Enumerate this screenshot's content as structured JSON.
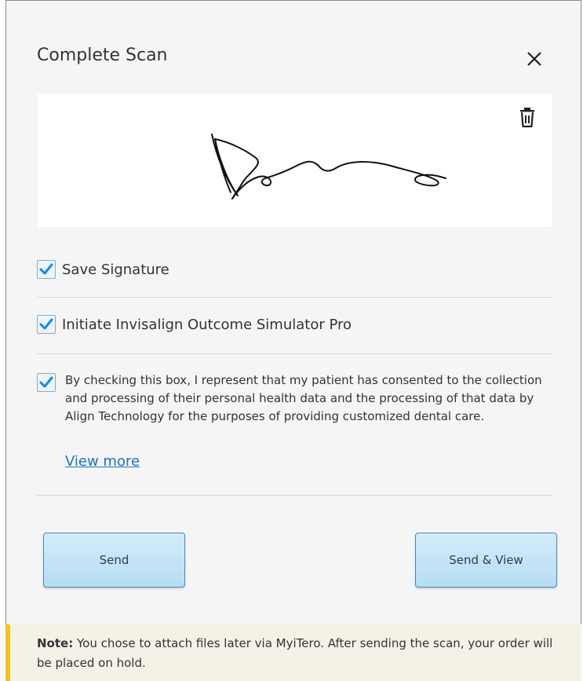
{
  "dialog": {
    "title": "Complete Scan",
    "close_icon": "close-icon",
    "signature": {
      "delete_icon": "trash-icon"
    },
    "checkboxes": [
      {
        "label": "Save Signature",
        "checked": true
      },
      {
        "label": "Initiate Invisalign Outcome Simulator Pro",
        "checked": true
      }
    ],
    "consent": {
      "checked": true,
      "text": "By checking this box, I represent that my patient has consented to the collection and processing of their personal health data and the processing of that data by Align Technology for the purposes of providing customized dental care.",
      "link": "View more"
    },
    "buttons": {
      "send": "Send",
      "send_view": "Send & View"
    }
  },
  "note": {
    "label": "Note:",
    "text": "You chose to attach files later via MyiTero. After sending the scan, your order will be placed on hold."
  },
  "colors": {
    "accent": "#1a73c8",
    "button_bg": "#c4e4f7",
    "note_stripe": "#f3c21b"
  }
}
